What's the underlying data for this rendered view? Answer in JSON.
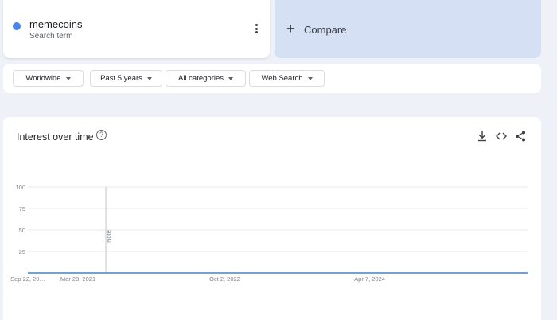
{
  "search_term": {
    "name": "memecoins",
    "subtitle": "Search term",
    "dot_color": "#4a86e8",
    "more_icon": "more-vert-icon"
  },
  "compare": {
    "plus_symbol": "+",
    "label": "Compare"
  },
  "filters": [
    {
      "label": "Worldwide"
    },
    {
      "label": "Past 5 years"
    },
    {
      "label": "All categories"
    },
    {
      "label": "Web Search"
    }
  ],
  "chart_card": {
    "title": "Interest over time",
    "help_symbol": "?",
    "tools": [
      "download-icon",
      "embed-code-icon",
      "share-icon"
    ]
  },
  "chart_data": {
    "type": "line",
    "title": "Interest over time",
    "xlabel": "",
    "ylabel": "",
    "ylim": [
      0,
      100
    ],
    "yticks": [
      25,
      50,
      75,
      100
    ],
    "grid": true,
    "line_color": "#4682c4",
    "x_ticks": [
      {
        "label": "Sep 22, 20…",
        "week": 0
      },
      {
        "label": "Mar 28, 2021",
        "week": 27
      },
      {
        "label": "Oct 2, 2022",
        "week": 106
      },
      {
        "label": "Apr 7, 2024",
        "week": 184
      }
    ],
    "annotation": {
      "label": "Note",
      "week": 42
    },
    "series": [
      {
        "values": [
          0,
          0,
          0,
          0,
          0,
          0,
          0,
          0,
          0,
          0,
          0,
          0,
          0,
          0,
          0,
          0,
          0,
          0,
          0,
          0,
          0,
          0,
          0,
          0,
          0,
          0,
          0,
          0,
          0,
          0,
          0,
          0,
          0,
          0,
          0,
          0,
          0,
          0,
          0,
          0,
          0,
          0,
          0,
          0,
          0,
          0,
          0,
          0,
          0,
          0,
          0,
          0,
          0,
          0,
          0,
          0,
          0,
          0,
          0,
          0,
          0,
          0,
          0,
          0,
          0,
          0,
          0,
          0,
          0,
          0,
          0,
          0,
          0,
          0,
          0,
          0,
          0,
          0,
          0,
          0,
          0,
          0,
          0,
          0,
          0,
          0,
          0,
          0,
          0,
          0,
          0,
          0,
          0,
          0,
          0,
          0,
          0,
          0,
          0,
          0,
          0,
          0,
          0,
          0,
          0,
          0,
          0,
          0,
          0,
          0,
          0,
          0,
          0,
          0,
          0,
          0,
          0,
          0,
          0,
          0,
          0,
          0,
          0,
          0,
          0,
          0,
          0,
          0,
          0,
          0,
          0,
          0,
          0,
          0,
          0,
          0,
          0,
          0,
          0,
          0,
          0,
          0,
          0,
          0,
          0,
          0,
          0,
          0,
          0,
          0,
          0,
          0,
          0,
          0,
          0,
          0,
          0,
          0,
          0,
          0,
          0,
          0,
          0,
          0,
          0,
          0,
          0,
          0,
          0,
          0,
          0,
          0,
          0,
          0,
          0,
          0,
          0,
          0,
          0,
          0,
          0,
          0,
          0,
          0,
          0,
          0,
          0,
          0,
          0,
          0,
          0,
          0,
          0,
          0,
          0,
          0,
          0,
          0,
          0,
          0,
          0,
          0,
          0,
          0,
          0,
          0,
          0,
          0,
          0,
          0,
          0,
          0,
          0,
          0,
          0,
          0,
          0,
          0,
          0,
          0,
          0,
          0,
          0,
          0,
          0,
          0,
          0,
          0,
          0,
          0,
          0,
          0,
          0,
          0,
          0,
          0,
          0,
          0,
          0,
          0,
          0,
          0,
          0,
          0,
          0,
          0,
          0,
          0,
          0,
          0,
          0,
          0,
          0,
          0,
          0,
          0,
          0,
          0,
          0,
          0,
          0,
          0,
          0,
          0,
          0,
          0,
          0,
          0,
          0,
          0
        ]
      }
    ]
  }
}
